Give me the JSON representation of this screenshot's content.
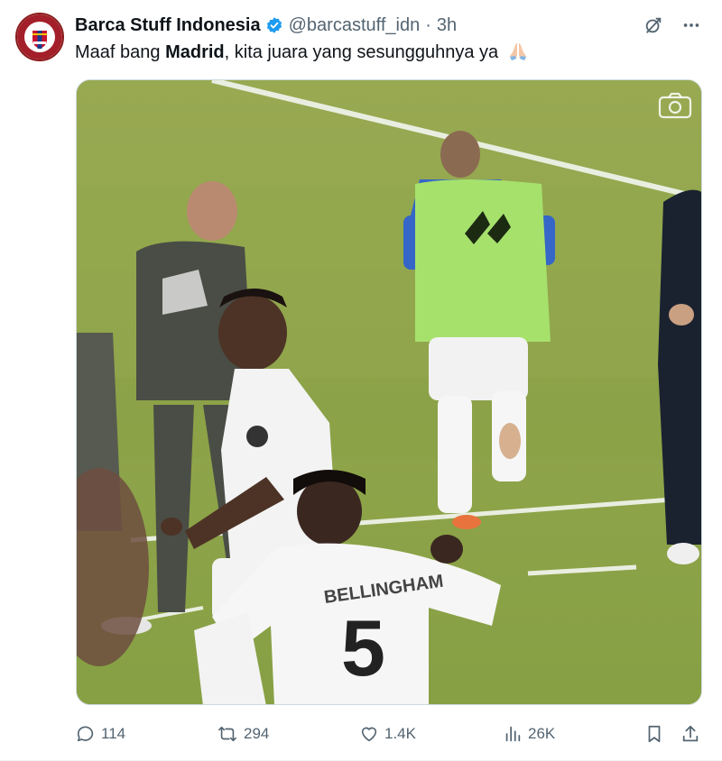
{
  "author": {
    "display_name": "Barca Stuff Indonesia",
    "handle": "@barcastuff_idn",
    "separator": "·",
    "time": "3h",
    "verified": true
  },
  "tweet": {
    "text_before": "Maaf bang ",
    "text_bold": "Madrid",
    "text_after": ", kita juara yang sesungguhnya ya",
    "emoji": "folded-hands"
  },
  "media": {
    "type": "video-still",
    "player_numbers": [
      "5"
    ],
    "shirt_text": "BELLINGHAM"
  },
  "stats": {
    "replies": "114",
    "retweets": "294",
    "likes": "1.4K",
    "views": "26K"
  },
  "icons": {
    "reply": "reply-icon",
    "retweet": "retweet-icon",
    "like": "heart-icon",
    "views": "views-icon",
    "bookmark": "bookmark-icon",
    "share": "share-icon",
    "grok": "grok-icon",
    "more": "more-icon",
    "camera": "camera-icon"
  },
  "colors": {
    "verified": "#1d9bf0",
    "secondary_text": "#536471",
    "pitch": "#8ea14a"
  }
}
